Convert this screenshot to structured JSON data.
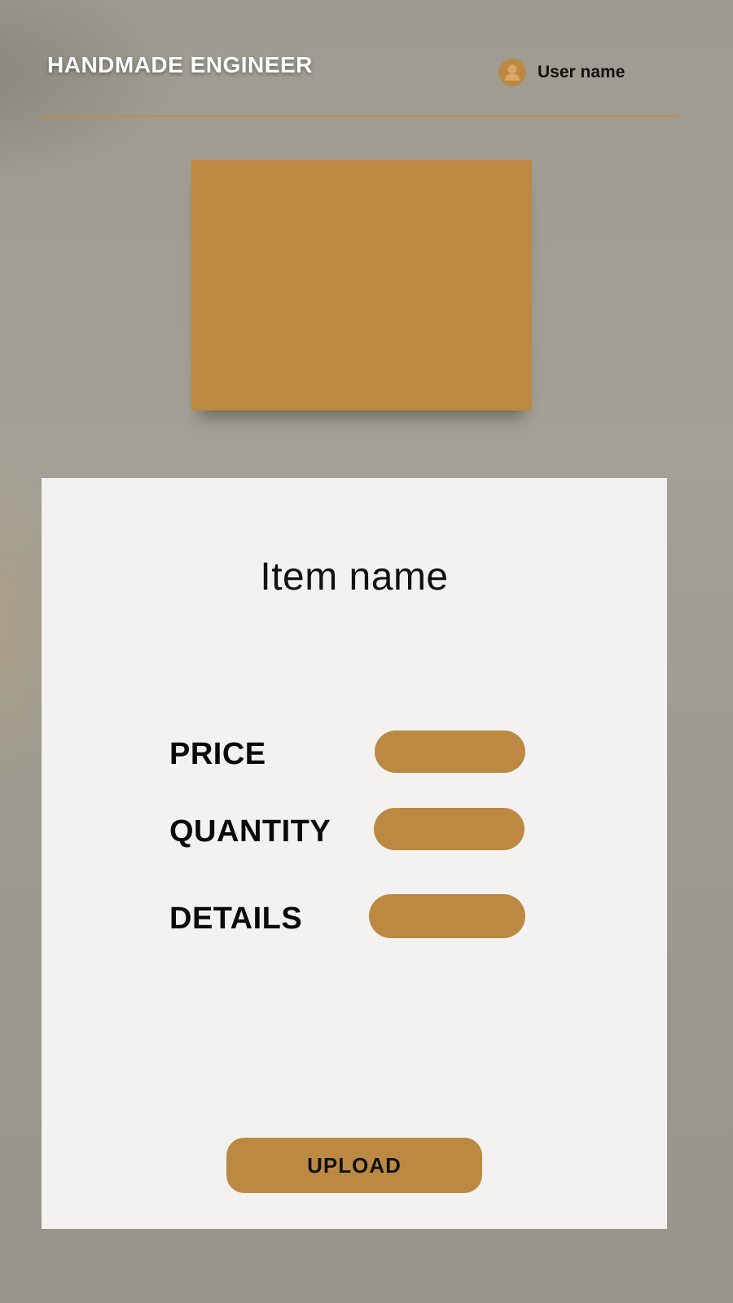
{
  "header": {
    "brand": "HANDMADE ENGINEER",
    "user_name": "User name",
    "avatar_icon": "user-icon"
  },
  "form": {
    "item_name": "Item name",
    "fields": [
      {
        "label": "PRICE",
        "value": ""
      },
      {
        "label": "QUANTITY",
        "value": ""
      },
      {
        "label": "DETAILS",
        "value": ""
      }
    ],
    "upload_label": "UPLOAD"
  },
  "colors": {
    "accent": "#bc8943",
    "card": "#f4f2f1",
    "background": "#9e9c91"
  }
}
